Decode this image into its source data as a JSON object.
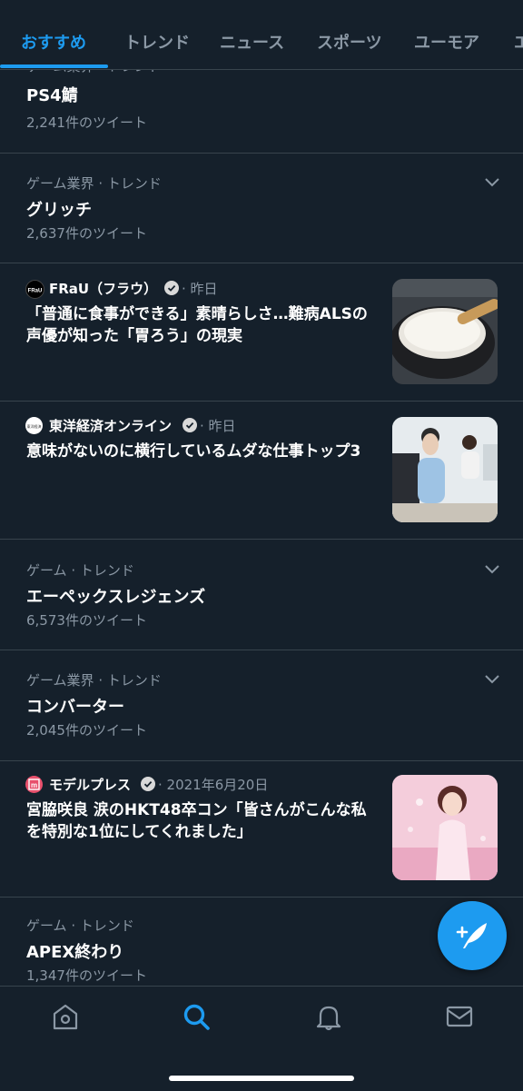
{
  "tabs": [
    "おすすめ",
    "トレンド",
    "ニュース",
    "スポーツ",
    "ユーモア",
    "エ"
  ],
  "trends": [
    {
      "meta": "ゲーム業界 · トレンド",
      "title": "PS4鯖",
      "count": "2,241件のツイート"
    },
    {
      "meta": "ゲーム業界 · トレンド",
      "title": "グリッチ",
      "count": "2,637件のツイート"
    },
    {
      "meta": "ゲーム · トレンド",
      "title": "エーペックスレジェンズ",
      "count": "6,573件のツイート"
    },
    {
      "meta": "ゲーム業界 · トレンド",
      "title": "コンバーター",
      "count": "2,045件のツイート"
    },
    {
      "meta": "ゲーム · トレンド",
      "title": "APEX終わり",
      "count": "1,347件のツイート"
    }
  ],
  "news": [
    {
      "source": "FRaU（フラウ）",
      "time": "· 昨日",
      "logo_text": "FRaU",
      "headline": "「普通に食事ができる」素晴らしさ…難病ALSの声優が知った「胃ろう」の現実"
    },
    {
      "source": "東洋経済オンライン",
      "time": "· 昨日",
      "logo_text": "東洋経済",
      "headline": "意味がないのに横行しているムダな仕事トップ3"
    },
    {
      "source": "モデルプレス",
      "time": "· 2021年6月20日",
      "logo_text": "m",
      "headline": "宮脇咲良 涙のHKT48卒コン「皆さんがこんな私を特別な1位にしてくれました」"
    }
  ],
  "colors": {
    "accent": "#1d9bf0",
    "background": "#15202b",
    "divider": "#38444d",
    "muted": "#8b98a5"
  },
  "nav": [
    "home-icon",
    "search-icon",
    "bell-icon",
    "mail-icon"
  ],
  "fab": "compose-tweet-icon"
}
